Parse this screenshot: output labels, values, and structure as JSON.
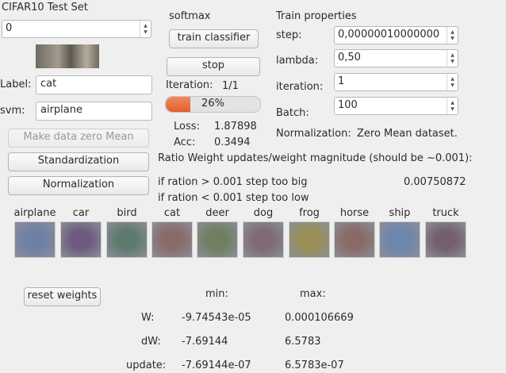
{
  "test_set": {
    "title": "CIFAR10 Test Set",
    "index_value": "0",
    "label_caption": "Label:",
    "label_value": "cat",
    "svm_caption": "svm:",
    "svm_value": "airplane",
    "btn_zero_mean": "Make  data zero Mean",
    "btn_standardization": "Standardization",
    "btn_normalization": "Normalization"
  },
  "training": {
    "method": "softmax",
    "btn_train": "train classifier",
    "btn_stop": "stop",
    "iteration_caption": "Iteration:",
    "iteration_value": "1/1",
    "progress_text": "26%",
    "progress_fraction": 0.26,
    "loss_caption": "Loss:",
    "loss_value": "1.87898",
    "acc_caption": "Acc:",
    "acc_value": "0.3494"
  },
  "train_properties": {
    "title": "Train properties",
    "step_caption": "step:",
    "step_value": "0,00000010000000",
    "lambda_caption": "lambda:",
    "lambda_value": "0,50",
    "iteration_caption": "iteration:",
    "iteration_value": "1",
    "batch_caption": "Batch:",
    "batch_value": "100",
    "normalization_caption": "Normalization:",
    "normalization_value": "Zero Mean dataset."
  },
  "ratio": {
    "heading": "Ratio Weight updates/weight magnitude  (should be ~0.001):",
    "rule_big_cond": "if ration > 0.001",
    "rule_big_text": "step too big",
    "rule_low_cond": "if ration < 0.001",
    "rule_low_text": "step too low",
    "value": "0.00750872"
  },
  "classes": [
    {
      "name": "airplane",
      "color": "#6f7fa6"
    },
    {
      "name": "car",
      "color": "#6e5a7e"
    },
    {
      "name": "bird",
      "color": "#5f7a6c"
    },
    {
      "name": "cat",
      "color": "#8a6a6a"
    },
    {
      "name": "deer",
      "color": "#6f7f5f"
    },
    {
      "name": "dog",
      "color": "#7e6a74"
    },
    {
      "name": "frog",
      "color": "#9a8f55"
    },
    {
      "name": "horse",
      "color": "#8a6a66"
    },
    {
      "name": "ship",
      "color": "#6c86ad"
    },
    {
      "name": "truck",
      "color": "#745f6e"
    }
  ],
  "stats": {
    "btn_reset": "reset weights",
    "min_header": "min:",
    "max_header": "max:",
    "rows": [
      {
        "label": "W:",
        "min": "-9.74543e-05",
        "max": "0.000106669"
      },
      {
        "label": "dW:",
        "min": "-7.69144",
        "max": "6.5783"
      },
      {
        "label": "update:",
        "min": "-7.69144e-07",
        "max": "6.5783e-07"
      }
    ]
  }
}
